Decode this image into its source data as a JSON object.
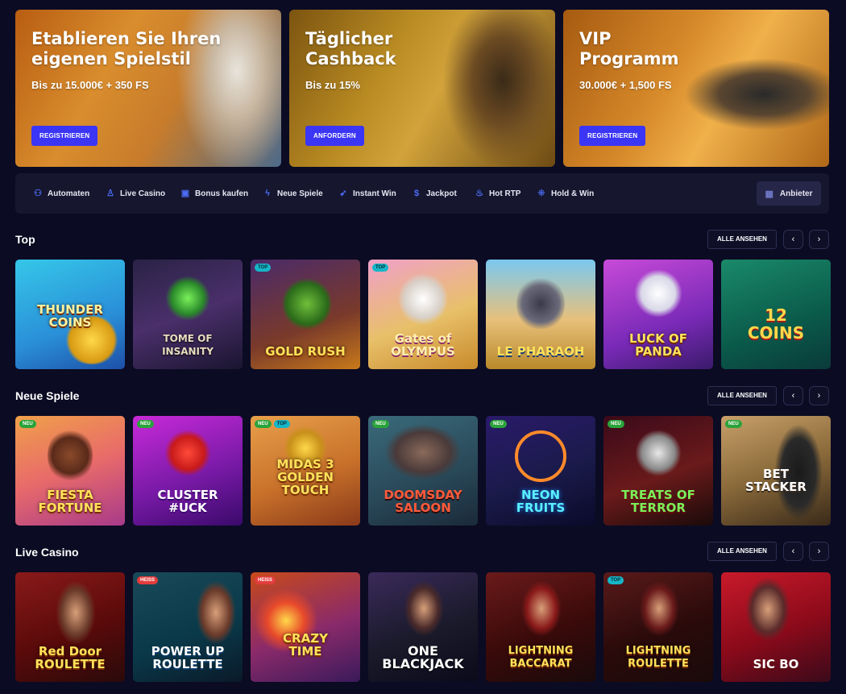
{
  "banners": [
    {
      "title": "Etablieren Sie Ihren\neigenen Spielstil",
      "subtitle": "Bis zu 15.000€ + 350 FS",
      "button": "REGISTRIEREN"
    },
    {
      "title": "Täglicher\nCashback",
      "subtitle": "Bis zu 15%",
      "button": "ANFORDERN"
    },
    {
      "title": "VIP\nProgramm",
      "subtitle": "30.000€ + 1,500 FS",
      "button": "REGISTRIEREN"
    }
  ],
  "categories": [
    {
      "label": "Automaten",
      "icon": "slot-icon"
    },
    {
      "label": "Live Casino",
      "icon": "dealer-icon"
    },
    {
      "label": "Bonus kaufen",
      "icon": "gift-icon"
    },
    {
      "label": "Neue Spiele",
      "icon": "lightning-icon"
    },
    {
      "label": "Instant Win",
      "icon": "rocket-icon"
    },
    {
      "label": "Jackpot",
      "icon": "moneybag-icon"
    },
    {
      "label": "Hot RTP",
      "icon": "flame-icon"
    },
    {
      "label": "Hold & Win",
      "icon": "grid-dots-icon"
    }
  ],
  "providers_label": "Anbieter",
  "view_all_label": "ALLE ANSEHEN",
  "sections": [
    {
      "title": "Top",
      "games": [
        {
          "name": "THUNDER\nCOINS",
          "badges": []
        },
        {
          "name": "TOME OF\nINSANITY",
          "badges": []
        },
        {
          "name": "GOLD RUSH",
          "badges": [
            "TOP"
          ]
        },
        {
          "name": "Gates of\nOLYMPUS",
          "badges": [
            "TOP"
          ]
        },
        {
          "name": "LE PHARAOH",
          "badges": []
        },
        {
          "name": "LUCK OF\nPANDA",
          "badges": []
        },
        {
          "name": "12\nCOINS",
          "badges": []
        }
      ]
    },
    {
      "title": "Neue Spiele",
      "games": [
        {
          "name": "FIESTA\nFORTUNE",
          "badges": [
            "NEU"
          ]
        },
        {
          "name": "CLUSTER\n#UCK",
          "badges": [
            "NEU"
          ]
        },
        {
          "name": "MIDAS 3\nGOLDEN TOUCH",
          "badges": [
            "NEU",
            "TOP"
          ]
        },
        {
          "name": "DOOMSDAY\nSALOON",
          "badges": [
            "NEU"
          ]
        },
        {
          "name": "NEON\nFRUITS",
          "badges": [
            "NEU"
          ]
        },
        {
          "name": "TREATS OF\nTERROR",
          "badges": [
            "NEU"
          ]
        },
        {
          "name": "BET\nSTACKER",
          "badges": [
            "NEU"
          ]
        }
      ]
    },
    {
      "title": "Live Casino",
      "games": [
        {
          "name": "Red Door\nROULETTE",
          "badges": []
        },
        {
          "name": "POWER UP\nROULETTE",
          "badges": [
            "HEISS"
          ]
        },
        {
          "name": "CRAZY\nTIME",
          "badges": [
            "HEISS"
          ]
        },
        {
          "name": "ONE\nBLACKJACK",
          "badges": []
        },
        {
          "name": "LIGHTNING\nBACCARAT",
          "badges": []
        },
        {
          "name": "LIGHTNING\nROULETTE",
          "badges": [
            "TOP"
          ]
        },
        {
          "name": "SIC BO",
          "badges": []
        }
      ]
    }
  ],
  "colors": {
    "background": "#0b0b23",
    "accent": "#3b35f5",
    "panel": "#16162f",
    "new_badge": "#2aa33a",
    "top_badge": "#16b6c8",
    "hot_badge": "#e23c3c"
  }
}
